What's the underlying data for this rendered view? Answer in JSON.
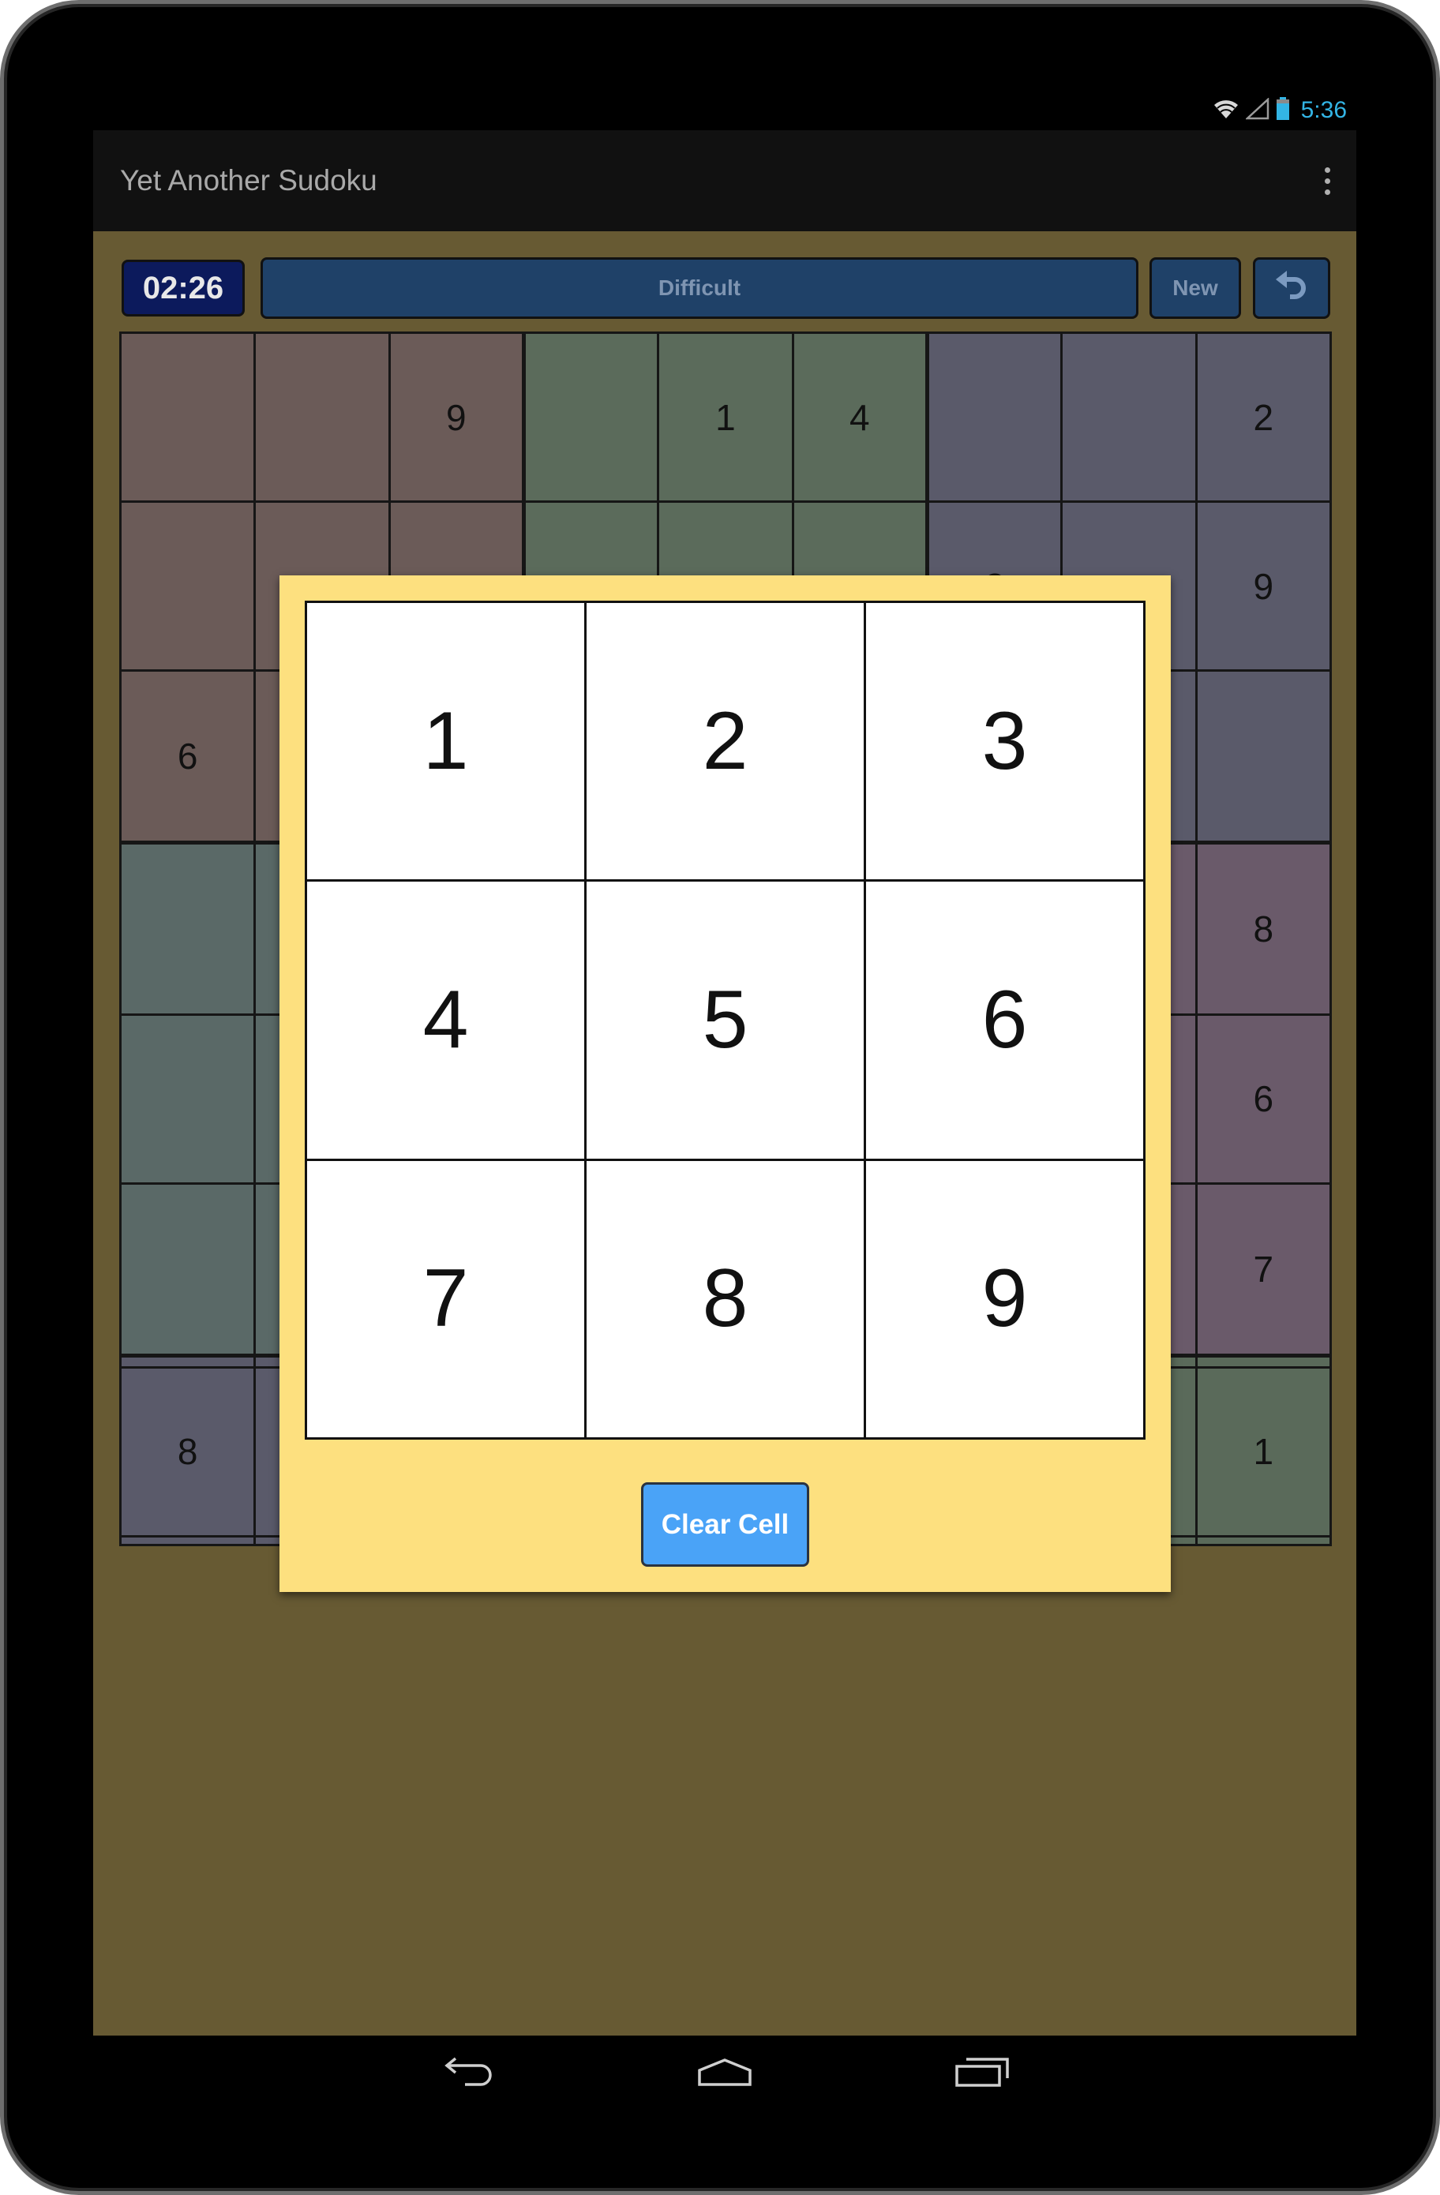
{
  "status_bar": {
    "time": "5:36",
    "icons": [
      "wifi-icon",
      "signal-icon",
      "battery-icon"
    ]
  },
  "action_bar": {
    "title": "Yet Another Sudoku",
    "overflow_icon": "more-vert-icon"
  },
  "toolbar": {
    "timer": "02:26",
    "difficulty": "Difficult",
    "new_label": "New",
    "undo_icon": "undo-icon"
  },
  "grid": {
    "rows": [
      [
        "",
        "",
        "9",
        "",
        "1",
        "4",
        "",
        "",
        "2"
      ],
      [
        "",
        "",
        "",
        "",
        "",
        "",
        "8",
        "",
        "9"
      ],
      [
        "6",
        "",
        "",
        "",
        "",
        "",
        "",
        "",
        ""
      ],
      [
        "",
        "",
        "",
        "",
        "",
        "",
        "",
        "",
        "8"
      ],
      [
        "",
        "",
        "",
        "",
        "",
        "",
        "",
        "",
        "6"
      ],
      [
        "",
        "",
        "",
        "",
        "",
        "",
        "",
        "",
        "7"
      ],
      [
        "",
        "",
        "",
        "",
        "",
        "",
        "",
        "",
        ""
      ],
      [
        "8",
        "",
        "",
        "",
        "",
        "",
        "",
        "",
        "1"
      ],
      [
        "",
        "",
        "",
        "",
        "",
        "",
        "",
        "",
        ""
      ]
    ],
    "box_colors": [
      [
        "#6b5b58",
        "#5b6b5b",
        "#5a5a6a"
      ],
      [
        "#5a6967",
        null,
        "#6a5a6a"
      ],
      [
        "#5a5a6a",
        null,
        "#5a6a5a"
      ]
    ]
  },
  "numpad": {
    "keys": [
      "1",
      "2",
      "3",
      "4",
      "5",
      "6",
      "7",
      "8",
      "9"
    ],
    "clear_label": "Clear Cell"
  },
  "nav_bar": {
    "icons": [
      "back-icon",
      "home-icon",
      "recents-icon"
    ]
  },
  "colors": {
    "background": "#675a33",
    "action_bar": "#111111",
    "dialog": "#fde07f",
    "clear_button": "#4aa3f7",
    "button": "#1f4168",
    "timer": "#0c1a5c",
    "accent": "#33b5e5"
  }
}
